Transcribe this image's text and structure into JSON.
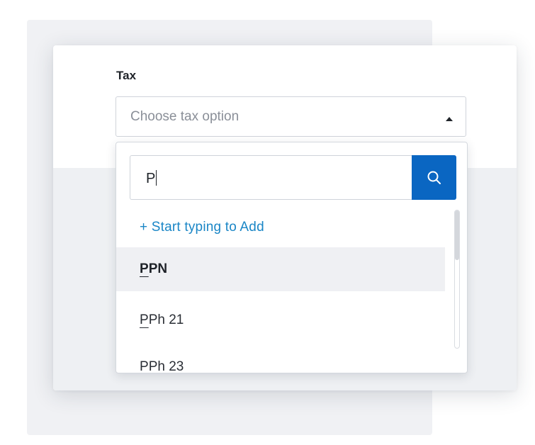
{
  "form": {
    "label": "Tax",
    "placeholder": "Choose tax option"
  },
  "dropdown": {
    "search_value": "P",
    "add_hint": "+ Start typing to Add",
    "options": [
      {
        "match": "P",
        "rest": "PN"
      },
      {
        "match": "P",
        "rest": "Ph 21"
      },
      {
        "match": "P",
        "rest": "Ph 23"
      }
    ]
  },
  "icons": {
    "search": "search-icon",
    "caret": "caret-up-icon"
  },
  "colors": {
    "accent": "#0a66c2",
    "link": "#1a86c6",
    "highlight": "#eff0f3"
  }
}
